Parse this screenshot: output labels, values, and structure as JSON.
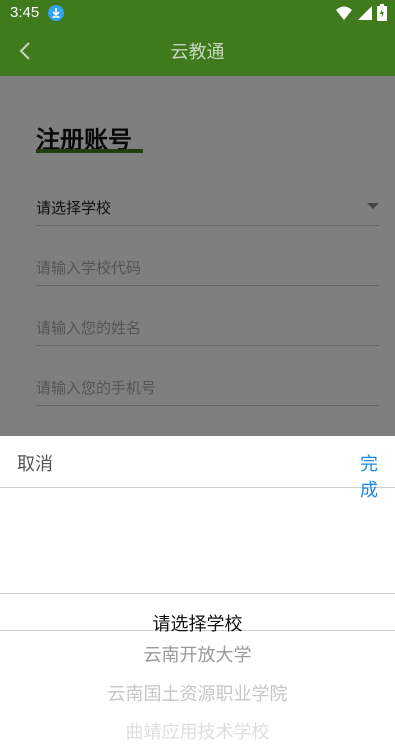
{
  "status_bar": {
    "time": "3:45",
    "icons": [
      "download-icon",
      "wifi-icon",
      "signal-icon",
      "battery-icon"
    ]
  },
  "app_bar": {
    "title": "云教通",
    "back_icon": "chevron-left-icon"
  },
  "form": {
    "heading": "注册账号",
    "school_select": {
      "value": "请选择学校"
    },
    "school_code": {
      "placeholder": "请输入学校代码"
    },
    "name": {
      "placeholder": "请输入您的姓名"
    },
    "phone": {
      "placeholder": "请输入您的手机号"
    }
  },
  "picker": {
    "cancel_label": "取消",
    "done_label": "完成",
    "options": [
      "请选择学校",
      "云南开放大学",
      "云南国土资源职业学院",
      "曲靖应用技术学校"
    ],
    "selected_index": 0
  },
  "colors": {
    "primary_green": "#3f7a1c",
    "link_blue": "#1e88e5"
  }
}
